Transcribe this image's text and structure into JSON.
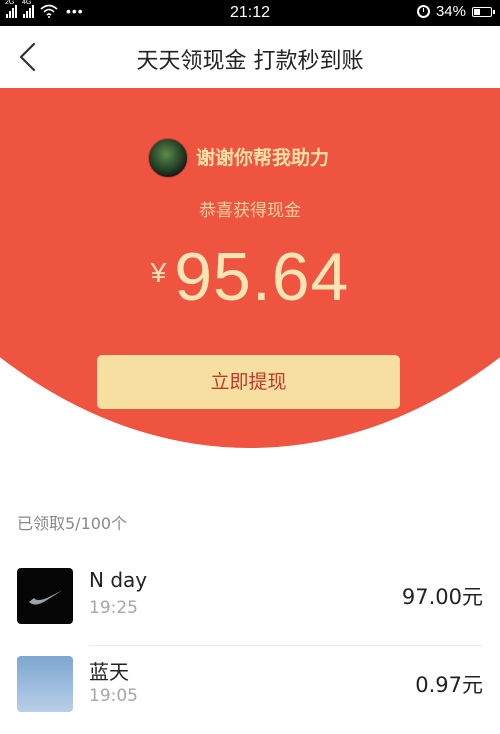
{
  "status_bar": {
    "network_1": "2G",
    "network_2": "4G",
    "time": "21:12",
    "battery": "34%",
    "battery_level": 0.34
  },
  "nav": {
    "title": "天天领现金 打款秒到账"
  },
  "hero": {
    "thanks_text": "谢谢你帮我助力",
    "congrats_text": "恭喜获得现金",
    "currency_symbol": "¥",
    "amount": "95.64",
    "withdraw_label": "立即提现",
    "bg_color": "#ef5440",
    "button_color": "#f7dfa1"
  },
  "list": {
    "count_text": "已领取5/100个",
    "items": [
      {
        "name": "N day",
        "time": "19:25",
        "amount": "97.00元",
        "avatar": "nike-logo-avatar"
      },
      {
        "name": "蓝天",
        "time": "19:05",
        "amount": "0.97元",
        "avatar": "sky-photo-avatar"
      }
    ]
  }
}
